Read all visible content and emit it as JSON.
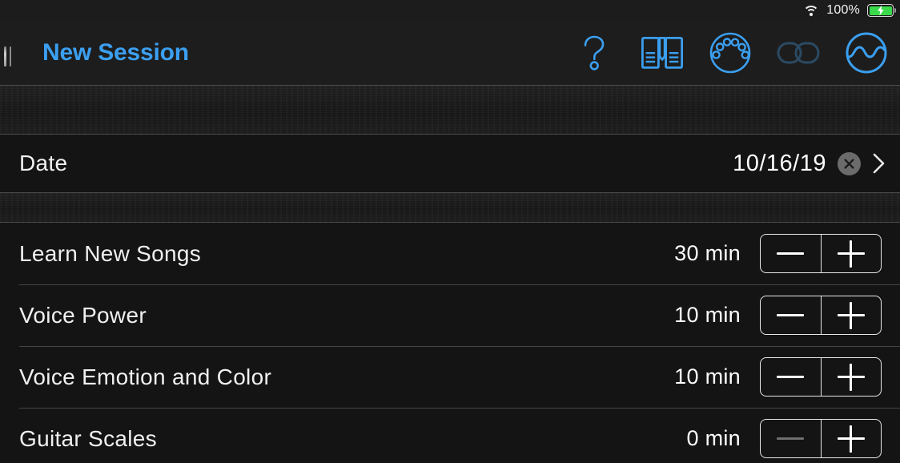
{
  "status_bar": {
    "wifi_icon": "wifi-icon",
    "battery_percent": "100%",
    "battery_icon": "battery-charging-icon",
    "battery_color": "#39d94b"
  },
  "title_bar": {
    "drag_handle": "drag-handle",
    "title": "New Session",
    "title_color": "#3b9ff0",
    "tools": [
      {
        "name": "help-icon",
        "label": "Help"
      },
      {
        "name": "songbook-icon",
        "label": "Songbook"
      },
      {
        "name": "metronome-icon",
        "label": "Metronome"
      },
      {
        "name": "link-icon",
        "label": "Link",
        "dimmed": true
      },
      {
        "name": "waveform-icon",
        "label": "Tuner"
      }
    ],
    "accent_color": "#3b9ff0",
    "dimmed_color": "#2b4a63"
  },
  "date_row": {
    "label": "Date",
    "value": "10/16/19",
    "clear_icon": "clear-circle-icon",
    "chevron_icon": "chevron-right-icon"
  },
  "activities": {
    "items": [
      {
        "label": "Learn New Songs",
        "value": "30 min",
        "minus_disabled": false
      },
      {
        "label": "Voice Power",
        "value": "10 min",
        "minus_disabled": false
      },
      {
        "label": "Voice Emotion and Color",
        "value": "10 min",
        "minus_disabled": false
      },
      {
        "label": "Guitar Scales",
        "value": "0 min",
        "minus_disabled": true
      }
    ],
    "decrement_label": "−",
    "increment_label": "+"
  }
}
